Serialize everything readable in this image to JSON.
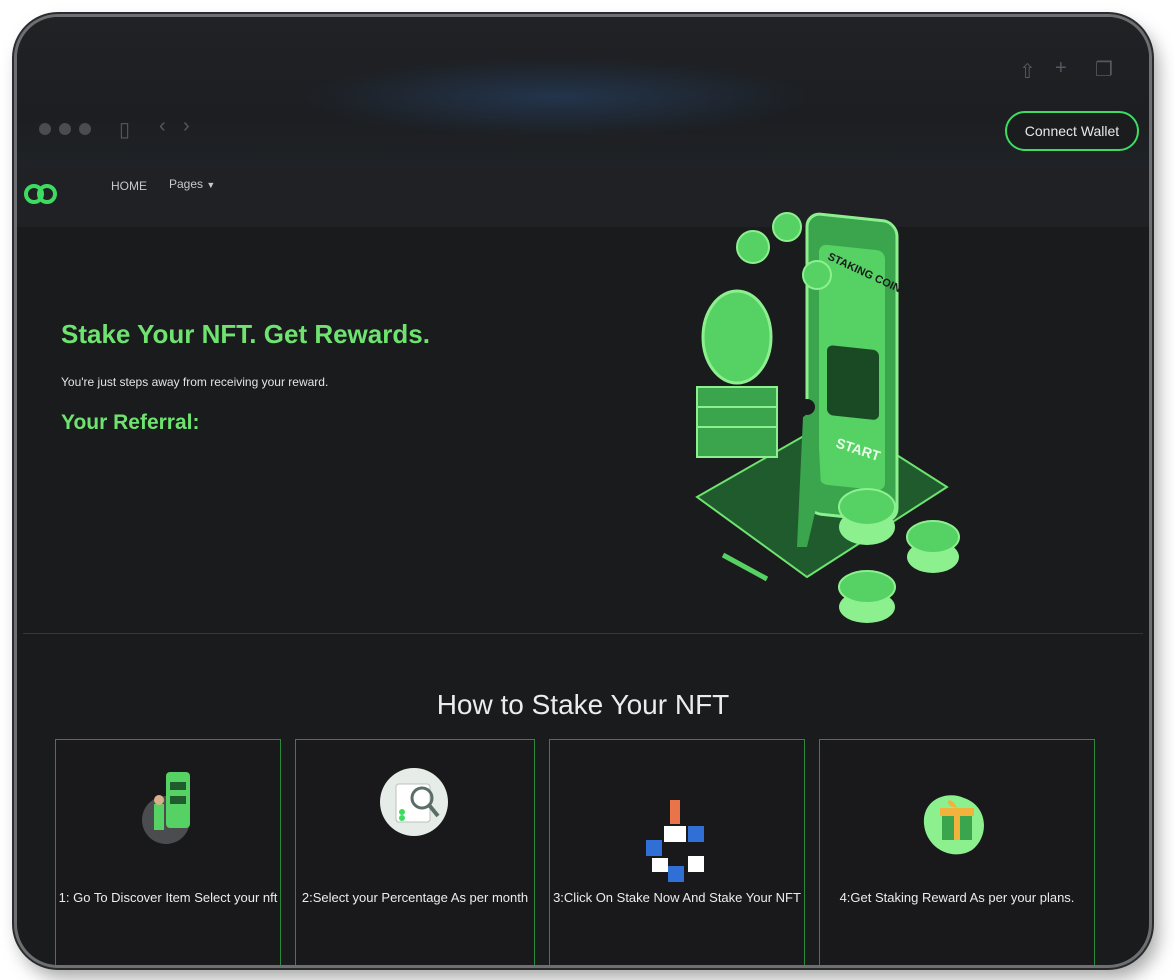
{
  "browser": {
    "connect_wallet_label": "Connect Wallet"
  },
  "nav": {
    "home_label": "HOME",
    "pages_label": "Pages"
  },
  "hero": {
    "title": "Stake Your NFT. Get Rewards.",
    "subtitle": "You're just steps away from receiving your reward.",
    "referral_label": "Your Referral:",
    "illustration_text_1": "STAKING COIN",
    "illustration_text_2": "START"
  },
  "how_to": {
    "title": "How to Stake Your NFT",
    "steps": [
      {
        "label": "1: Go To Discover Item Select your nft"
      },
      {
        "label": "2:Select your Percentage As per month"
      },
      {
        "label": "3:Click On Stake Now And Stake Your NFT"
      },
      {
        "label": "4:Get Staking Reward As per your plans."
      }
    ]
  },
  "colors": {
    "accent": "#6ee36f",
    "background": "#1a1b1d",
    "card_border": "#2c8a3e"
  }
}
